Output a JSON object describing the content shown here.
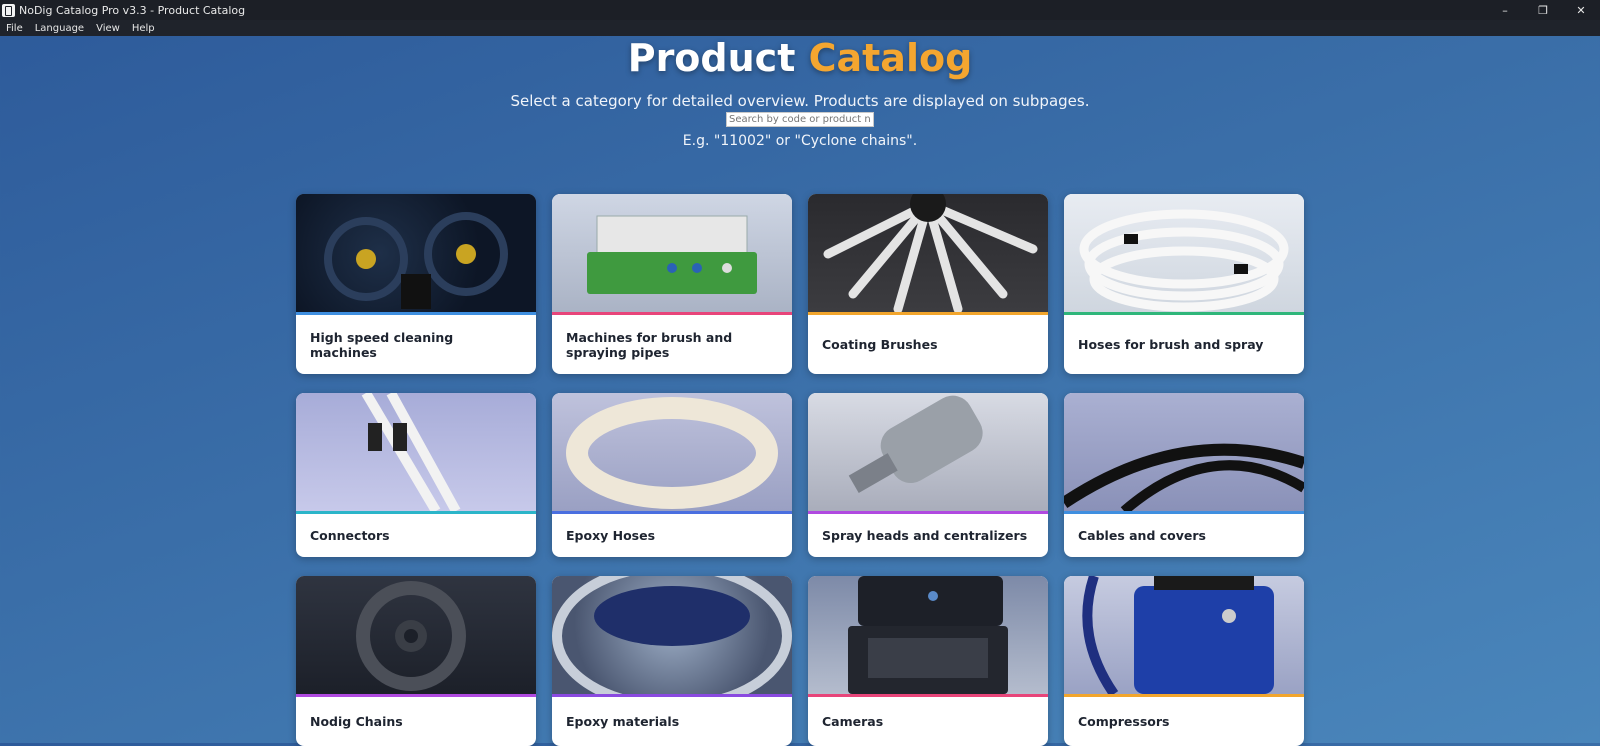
{
  "window": {
    "title": "NoDig Catalog Pro v3.3 - Product Catalog",
    "controls": {
      "minimize": "–",
      "restore": "❐",
      "close": "✕"
    }
  },
  "menu": [
    "File",
    "Language",
    "View",
    "Help"
  ],
  "hero": {
    "title_main": "Product",
    "title_accent": "Catalog",
    "accent_color": "#f4a630",
    "subtitle": "Select a category for detailed overview. Products are displayed on subpages.",
    "search_placeholder": "Search by code or product name",
    "example": "E.g. \"11002\" or \"Cyclone chains\"."
  },
  "categories": [
    {
      "label": "High speed cleaning machines",
      "accent": "#3f8fe0"
    },
    {
      "label": "Machines for brush and spraying pipes",
      "accent": "#e8457a"
    },
    {
      "label": "Coating Brushes",
      "accent": "#f2a52c"
    },
    {
      "label": "Hoses for brush and spray",
      "accent": "#2fb67a"
    },
    {
      "label": "Connectors",
      "accent": "#2bb5c9"
    },
    {
      "label": "Epoxy Hoses",
      "accent": "#4a6fe0"
    },
    {
      "label": "Spray heads and centralizers",
      "accent": "#b04ae0"
    },
    {
      "label": "Cables and covers",
      "accent": "#3f8fe0"
    },
    {
      "label": "Nodig Chains",
      "accent": "#b04ae0"
    },
    {
      "label": "Epoxy materials",
      "accent": "#8a4ae0"
    },
    {
      "label": "Cameras",
      "accent": "#e8457a"
    },
    {
      "label": "Compressors",
      "accent": "#f2a52c"
    }
  ]
}
